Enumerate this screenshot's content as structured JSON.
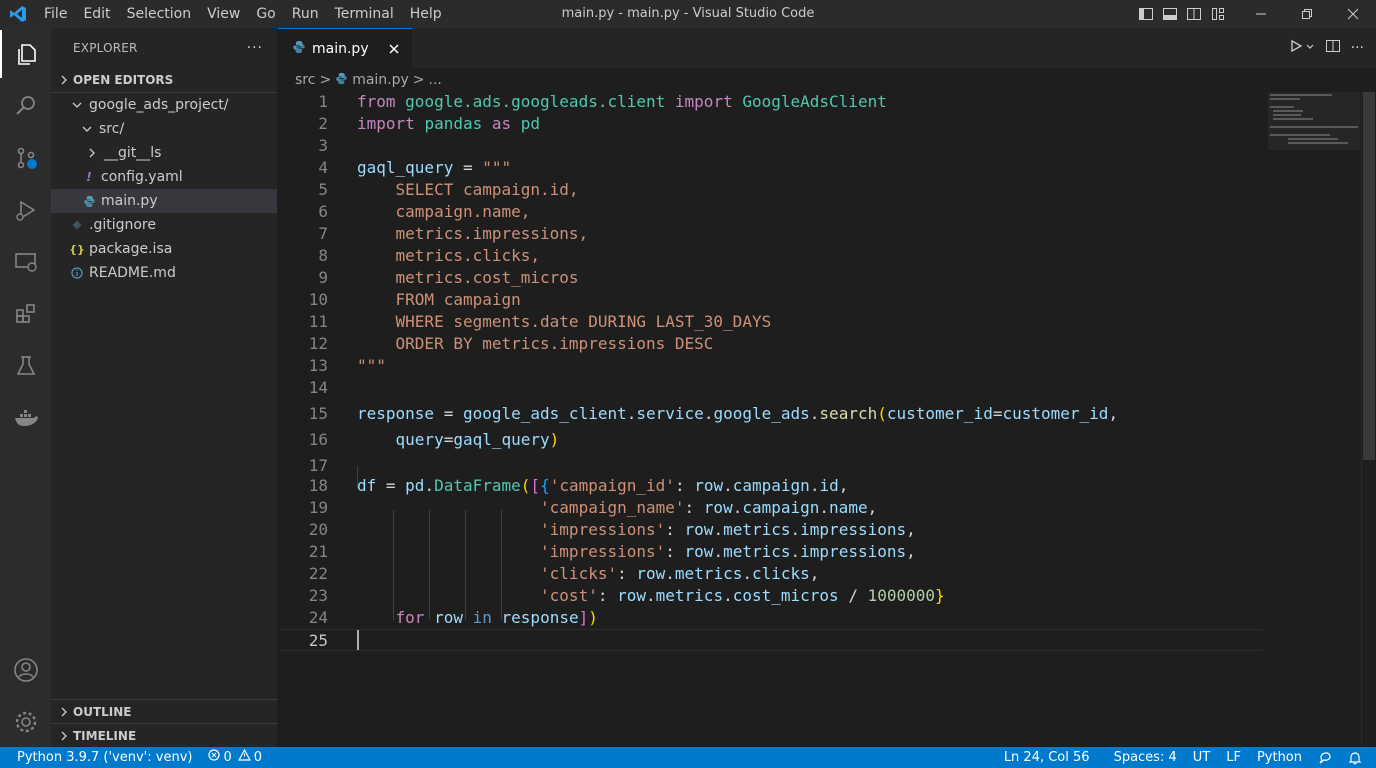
{
  "window": {
    "title": "main.py - main.py - Visual Studio Code",
    "menu": [
      "File",
      "Edit",
      "Selection",
      "View",
      "Go",
      "Run",
      "Terminal",
      "Help"
    ]
  },
  "colors": {
    "accent": "#007acc",
    "tab_border": "#0078d4",
    "statusbar": "#007acc"
  },
  "icons": {
    "activity": [
      "explorer-icon",
      "search-icon",
      "source-control-icon",
      "run-debug-icon",
      "remote-explorer-icon",
      "extensions-icon",
      "testing-icon",
      "docker-icon",
      "accounts-icon",
      "settings-gear-icon"
    ]
  },
  "sidebar": {
    "title": "EXPLORER",
    "open_editors": "OPEN EDITORS",
    "tree": [
      {
        "label": "google_ads_project/",
        "icon": "chevron-down-icon"
      },
      {
        "label": "src/",
        "icon": "chevron-down-icon"
      },
      {
        "label": "__git__ls",
        "icon": "chevron-right-icon"
      },
      {
        "label": "config.yaml",
        "icon": "yaml-file-icon"
      },
      {
        "label": "main.py",
        "icon": "python-file-icon"
      },
      {
        "label": ".gitignore",
        "icon": "git-file-icon"
      },
      {
        "label": "package.isa",
        "icon": "json-file-icon"
      },
      {
        "label": "README.md",
        "icon": "info-file-icon"
      }
    ],
    "outline": "OUTLINE",
    "timeline": "TIMELINE"
  },
  "editor": {
    "tab_label": "main.py",
    "breadcrumb": [
      "src",
      ">",
      "main.py",
      ">",
      "..."
    ],
    "current_line": "25",
    "line_numbers": [
      "1",
      "2",
      "3",
      "4",
      "5",
      "6",
      "7",
      "8",
      "9",
      "10",
      "11",
      "12",
      "13",
      "14",
      "15",
      "16",
      "17",
      "18",
      "19",
      "20",
      "21",
      "22",
      "23",
      "24",
      "25"
    ],
    "lines": [
      [
        [
          "kw",
          "from"
        ],
        [
          "op",
          " "
        ],
        [
          "mod",
          "google.ads.googleads.client"
        ],
        [
          "op",
          " "
        ],
        [
          "kw",
          "import"
        ],
        [
          "op",
          " "
        ],
        [
          "mod",
          "GoogleAdsClient"
        ]
      ],
      [
        [
          "kw",
          "import"
        ],
        [
          "op",
          " "
        ],
        [
          "mod",
          "pandas"
        ],
        [
          "op",
          " "
        ],
        [
          "kw",
          "as"
        ],
        [
          "op",
          " "
        ],
        [
          "mod",
          "pd"
        ]
      ],
      [],
      [
        [
          "var",
          "gaql_query"
        ],
        [
          "op",
          " = "
        ],
        [
          "str",
          "\"\"\""
        ]
      ],
      [
        [
          "str",
          "    SELECT campaign.id,"
        ]
      ],
      [
        [
          "str",
          "    campaign.name,"
        ]
      ],
      [
        [
          "str",
          "    metrics.impressions,"
        ]
      ],
      [
        [
          "str",
          "    metrics.clicks,"
        ]
      ],
      [
        [
          "str",
          "    metrics.cost_micros"
        ]
      ],
      [
        [
          "str",
          "    FROM campaign"
        ]
      ],
      [
        [
          "str",
          "    WHERE segments.date DURING LAST_30_DAYS"
        ]
      ],
      [
        [
          "str",
          "    ORDER BY metrics.impressions DESC"
        ]
      ],
      [
        [
          "str",
          "\"\"\""
        ]
      ],
      [],
      [
        [
          "var",
          "response"
        ],
        [
          "op",
          " = "
        ],
        [
          "var",
          "google_ads_client"
        ],
        [
          "op",
          "."
        ],
        [
          "var",
          "service"
        ],
        [
          "op",
          "."
        ],
        [
          "var",
          "google_ads"
        ],
        [
          "op",
          "."
        ],
        [
          "fn",
          "search"
        ],
        [
          "br1",
          "("
        ],
        [
          "var",
          "customer_id"
        ],
        [
          "op",
          "="
        ],
        [
          "var",
          "customer_id"
        ],
        [
          "op",
          ","
        ]
      ],
      [
        [
          "op",
          "    "
        ],
        [
          "var",
          "query"
        ],
        [
          "op",
          "="
        ],
        [
          "var",
          "gaql_query"
        ],
        [
          "br1",
          ")"
        ]
      ],
      [],
      [
        [
          "var",
          "df"
        ],
        [
          "op",
          " = "
        ],
        [
          "var",
          "pd"
        ],
        [
          "op",
          "."
        ],
        [
          "mod",
          "DataFrame"
        ],
        [
          "br1",
          "("
        ],
        [
          "br2",
          "["
        ],
        [
          "br3",
          "{"
        ],
        [
          "str",
          "'campaign_id'"
        ],
        [
          "op",
          ": "
        ],
        [
          "var",
          "row"
        ],
        [
          "op",
          "."
        ],
        [
          "var",
          "campaign"
        ],
        [
          "op",
          "."
        ],
        [
          "var",
          "id"
        ],
        [
          "op",
          ","
        ]
      ],
      [
        [
          "op",
          "                   "
        ],
        [
          "str",
          "'campaign_name'"
        ],
        [
          "op",
          ": "
        ],
        [
          "var",
          "row"
        ],
        [
          "op",
          "."
        ],
        [
          "var",
          "campaign"
        ],
        [
          "op",
          "."
        ],
        [
          "var",
          "name"
        ],
        [
          "op",
          ","
        ]
      ],
      [
        [
          "op",
          "                   "
        ],
        [
          "str",
          "'impressions'"
        ],
        [
          "op",
          ": "
        ],
        [
          "var",
          "row"
        ],
        [
          "op",
          "."
        ],
        [
          "var",
          "metrics"
        ],
        [
          "op",
          "."
        ],
        [
          "var",
          "impressions"
        ],
        [
          "op",
          ","
        ]
      ],
      [
        [
          "op",
          "                   "
        ],
        [
          "str",
          "'impressions'"
        ],
        [
          "op",
          ": "
        ],
        [
          "var",
          "row"
        ],
        [
          "op",
          "."
        ],
        [
          "var",
          "metrics"
        ],
        [
          "op",
          "."
        ],
        [
          "var",
          "impressions"
        ],
        [
          "op",
          ","
        ]
      ],
      [
        [
          "op",
          "                   "
        ],
        [
          "str",
          "'clicks'"
        ],
        [
          "op",
          ": "
        ],
        [
          "var",
          "row"
        ],
        [
          "op",
          "."
        ],
        [
          "var",
          "metrics"
        ],
        [
          "op",
          "."
        ],
        [
          "var",
          "clicks"
        ],
        [
          "op",
          ","
        ]
      ],
      [
        [
          "op",
          "                   "
        ],
        [
          "str",
          "'cost'"
        ],
        [
          "op",
          ": "
        ],
        [
          "var",
          "row"
        ],
        [
          "op",
          "."
        ],
        [
          "var",
          "metrics"
        ],
        [
          "op",
          "."
        ],
        [
          "var",
          "cost_micros"
        ],
        [
          "op",
          " / "
        ],
        [
          "num",
          "1000000"
        ],
        [
          "br1",
          "}"
        ]
      ],
      [
        [
          "op",
          "    "
        ],
        [
          "kw",
          "for"
        ],
        [
          "op",
          " "
        ],
        [
          "var",
          "row"
        ],
        [
          "op",
          " "
        ],
        [
          "kw2",
          "in"
        ],
        [
          "op",
          " "
        ],
        [
          "var",
          "response"
        ],
        [
          "br2",
          "]"
        ],
        [
          "br1",
          ")"
        ]
      ],
      []
    ]
  },
  "statusbar": {
    "interpreter": "Python 3.9.7 ('venv': venv)",
    "errors": "0",
    "warnings": "0",
    "position": "Ln 24, Col 56",
    "spaces": "Spaces: 4",
    "encoding": "UT",
    "eol": "LF",
    "language": "Python"
  }
}
